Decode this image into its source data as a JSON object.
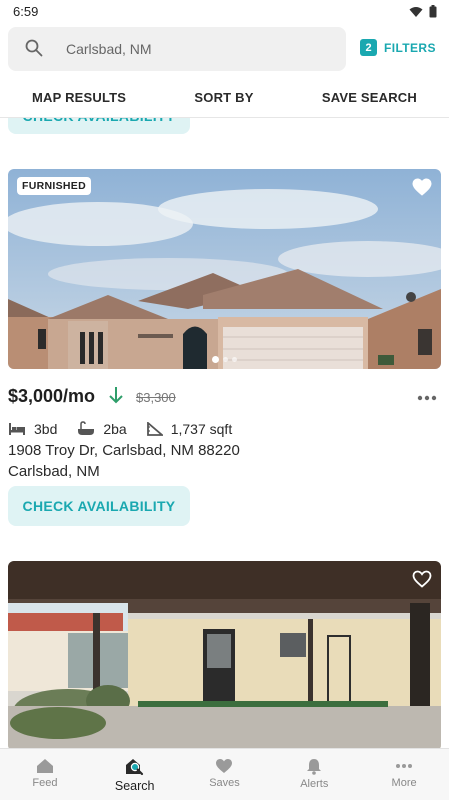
{
  "status_bar": {
    "time": "6:59"
  },
  "search": {
    "placeholder": "Carlsbad, NM"
  },
  "filters": {
    "count": "2",
    "label": "FILTERS"
  },
  "actions": {
    "map_results": "MAP RESULTS",
    "sort_by": "SORT BY",
    "save_search": "SAVE SEARCH"
  },
  "previous_listing": {
    "button_label": "CHECK AVAILABILITY"
  },
  "listing": {
    "badge": "FURNISHED",
    "price": "$3,000/mo",
    "old_price": "$3,300",
    "beds": "3bd",
    "baths": "2ba",
    "sqft": "1,737 sqft",
    "address_line1": "1908 Troy Dr, Carlsbad, NM 88220",
    "address_line2": "Carlsbad, NM",
    "button_label": "CHECK AVAILABILITY",
    "photo_index": 1,
    "photo_count": 3
  },
  "colors": {
    "accent": "#1aa8b0",
    "accent_light": "#dff3f4",
    "price_drop": "#2e9e6a"
  },
  "bottom_nav": {
    "items": [
      {
        "label": "Feed",
        "icon": "home-icon"
      },
      {
        "label": "Search",
        "icon": "search-home-icon",
        "active": true
      },
      {
        "label": "Saves",
        "icon": "heart-icon"
      },
      {
        "label": "Alerts",
        "icon": "bell-icon"
      },
      {
        "label": "More",
        "icon": "more-icon"
      }
    ]
  }
}
